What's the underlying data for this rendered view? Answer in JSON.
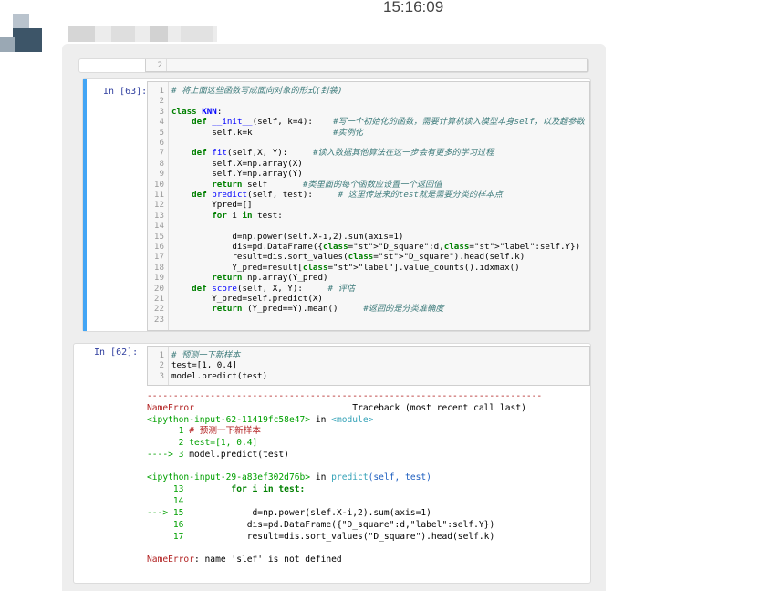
{
  "clock": "15:16:09",
  "cell0": {
    "lines": [
      "2"
    ]
  },
  "cell1": {
    "prompt": "In  [63]:",
    "lines": [
      {
        "n": "1",
        "t": "# 将上面这些函数写成面向对象的形式(封装)"
      },
      {
        "n": "2",
        "t": ""
      },
      {
        "n": "3",
        "t": "class KNN:"
      },
      {
        "n": "4",
        "t": "    def __init__(self, k=4):    #写一个初始化的函数，需要计算机读入模型本身self，以及超参数"
      },
      {
        "n": "5",
        "t": "        self.k=k                #实例化"
      },
      {
        "n": "6",
        "t": ""
      },
      {
        "n": "7",
        "t": "    def fit(self,X, Y):     #读入数据其他算法在这一步会有更多的学习过程"
      },
      {
        "n": "8",
        "t": "        self.X=np.array(X)"
      },
      {
        "n": "9",
        "t": "        self.Y=np.array(Y)"
      },
      {
        "n": "10",
        "t": "        return self       #类里面的每个函数应设置一个返回值"
      },
      {
        "n": "11",
        "t": "    def predict(self, test):     # 这里传进来的test就是需要分类的样本点"
      },
      {
        "n": "12",
        "t": "        Ypred=[]"
      },
      {
        "n": "13",
        "t": "        for i in test:"
      },
      {
        "n": "14",
        "t": ""
      },
      {
        "n": "15",
        "t": "            d=np.power(self.X-i,2).sum(axis=1)"
      },
      {
        "n": "16",
        "t": "            dis=pd.DataFrame({\"D_square\":d,\"label\":self.Y})"
      },
      {
        "n": "17",
        "t": "            result=dis.sort_values(\"D_square\").head(self.k)"
      },
      {
        "n": "18",
        "t": "            Y_pred=result[\"label\"].value_counts().idxmax()"
      },
      {
        "n": "19",
        "t": "        return np.array(Y_pred)"
      },
      {
        "n": "20",
        "t": "    def score(self, X, Y):     # 评估"
      },
      {
        "n": "21",
        "t": "        Y_pred=self.predict(X)"
      },
      {
        "n": "22",
        "t": "        return (Y_pred==Y).mean()     #返回的是分类准确度"
      },
      {
        "n": "23",
        "t": ""
      }
    ]
  },
  "cell2": {
    "prompt": "In  [62]:",
    "lines": [
      {
        "n": "1",
        "t": "# 预测一下新样本"
      },
      {
        "n": "2",
        "t": "test=[1, 0.4]"
      },
      {
        "n": "3",
        "t": "model.predict(test)"
      }
    ],
    "output": {
      "rule": "---------------------------------------------------------------------------",
      "err_name": "NameError",
      "traceback": "                              Traceback (most recent call last)",
      "input1": "<ipython-input-62-11419fc58e47>",
      "in1": " in ",
      "module": "<module>",
      "l1n": "      1 ",
      "l1t": "# 预测一下新样本",
      "l2": "      2 test=[1, 0.4]",
      "arrow3": "----> 3 ",
      "l3t": "model.predict(test)",
      "input2": "<ipython-input-29-a83ef302d76b>",
      "in2": " in ",
      "func": "predict",
      "args": "(self, test)",
      "l13n": "     13 ",
      "l13t": "        for i in test:",
      "l14": "     14",
      "arrow15": "---> 15 ",
      "l15t": "            d=np.power(slef.X-i,2).sum(axis=1)",
      "l16n": "     16 ",
      "l16t": "           dis=pd.DataFrame({\"D_square\":d,\"label\":self.Y})",
      "l17n": "     17 ",
      "l17t": "           result=dis.sort_values(\"D_square\").head(self.k)",
      "final_name": "NameError",
      "final_msg": ": name 'slef' is not defined"
    }
  }
}
